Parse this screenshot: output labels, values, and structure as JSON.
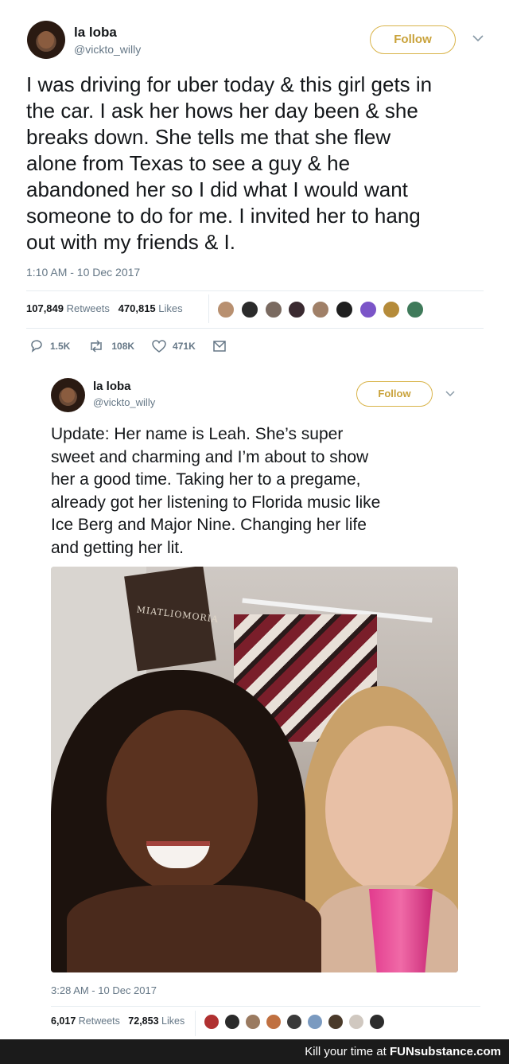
{
  "tweet1": {
    "name": "la loba",
    "handle": "@vickto_willy",
    "follow_label": "Follow",
    "text": "I was driving for uber today & this girl gets in\nthe car. I ask her hows her day been & she\nbreaks down. She tells me that she flew\nalone from Texas to see a guy & he\nabandoned her so I did what I would want\nsomeone to do for me. I invited her to hang\nout with my friends & I.",
    "timestamp": "1:10 AM - 10 Dec 2017",
    "retweets_count": "107,849",
    "retweets_label": "Retweets",
    "likes_count": "470,815",
    "likes_label": "Likes",
    "replies": "1.5K",
    "retweets_short": "108K",
    "likes_short": "471K"
  },
  "tweet2": {
    "name": "la loba",
    "handle": "@vickto_willy",
    "follow_label": "Follow",
    "text": "Update: Her name is Leah. She’s super\nsweet and charming and I’m about to show\nher a good time. Taking her to a pregame,\nalready got her listening to Florida music like\nIce Berg and Major Nine. Changing her life\nand getting her lit.",
    "timestamp": "3:28 AM - 10 Dec 2017",
    "retweets_count": "6,017",
    "retweets_label": "Retweets",
    "likes_count": "72,853",
    "likes_label": "Likes"
  },
  "footer": {
    "prefix": "Kill your time at ",
    "brand": "FUNsubstance.com"
  },
  "colors": {
    "follow_gold": "#c9a23a",
    "muted": "#657786",
    "footer_bg": "#1b1b1b"
  }
}
